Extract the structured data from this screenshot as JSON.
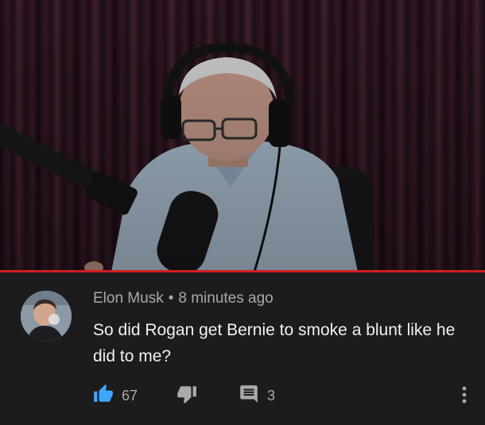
{
  "video": {
    "progress_fraction": 1.0,
    "progress_color": "#d11f1f"
  },
  "comment": {
    "author": "Elon Musk",
    "separator": "•",
    "time": "8 minutes ago",
    "text": "So did Rogan get Bernie to smoke a blunt like he did to me?",
    "likes": "67",
    "replies": "3",
    "like_icon": "thumbs-up-icon",
    "dislike_icon": "thumbs-down-icon",
    "reply_icon": "comment-icon",
    "more_icon": "more-vertical-icon",
    "like_color": "#3ea6ff"
  }
}
